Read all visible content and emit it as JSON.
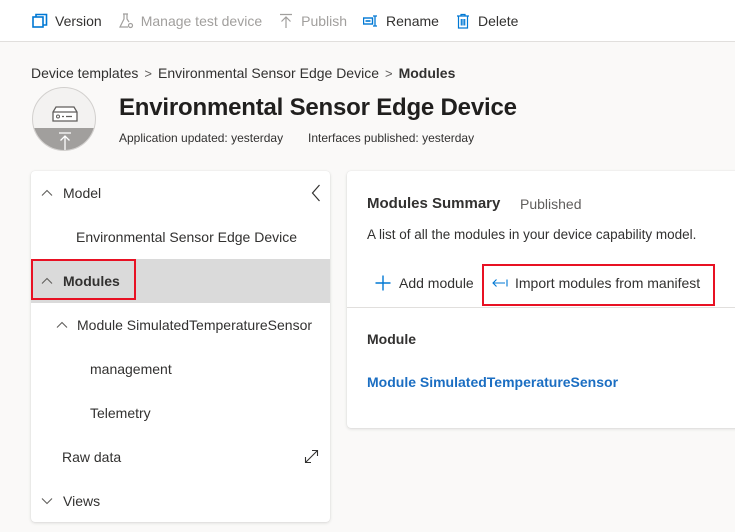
{
  "toolbar": {
    "items": [
      {
        "label": "Version",
        "icon": "version-icon",
        "disabled": false
      },
      {
        "label": "Manage test device",
        "icon": "flask-icon",
        "disabled": true
      },
      {
        "label": "Publish",
        "icon": "publish-icon",
        "disabled": true
      },
      {
        "label": "Rename",
        "icon": "rename-icon",
        "disabled": false
      },
      {
        "label": "Delete",
        "icon": "trash-icon",
        "disabled": false
      }
    ]
  },
  "breadcrumb": {
    "items": [
      "Device templates",
      "Environmental Sensor Edge Device",
      "Modules"
    ],
    "separator": ">"
  },
  "header": {
    "title": "Environmental Sensor Edge Device",
    "app_updated": "Application updated: yesterday",
    "interfaces_published": "Interfaces published: yesterday"
  },
  "sidebar": {
    "items": [
      {
        "label": "Model",
        "chevron": "up",
        "level": 0
      },
      {
        "label": "Environmental Sensor Edge Device",
        "level": 1
      },
      {
        "label": "Modules",
        "chevron": "up",
        "level": 0,
        "selected": true,
        "highlighted": true
      },
      {
        "label": "Module SimulatedTemperatureSensor",
        "chevron": "up",
        "level": 1
      },
      {
        "label": "management",
        "level": 2
      },
      {
        "label": "Telemetry",
        "level": 2
      },
      {
        "label": "Raw data",
        "level": 0,
        "icon": "expand-icon"
      },
      {
        "label": "Views",
        "chevron": "down",
        "level": 0
      }
    ]
  },
  "card": {
    "title": "Modules Summary",
    "status": "Published",
    "description": "A list of all the modules in your device capability model.",
    "add_module_label": "Add module",
    "import_label": "Import modules from manifest",
    "column_header": "Module",
    "modules": [
      "Module SimulatedTemperatureSensor"
    ]
  },
  "colors": {
    "accent": "#0078d4",
    "link": "#1b6ec2",
    "highlight_box": "#e81123",
    "selected_bg": "#dadada"
  }
}
